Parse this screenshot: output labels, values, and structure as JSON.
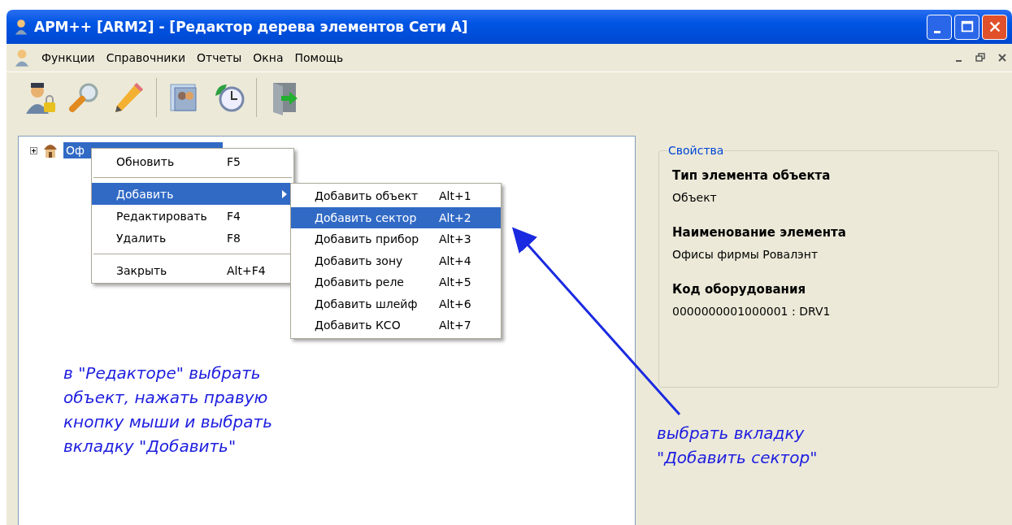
{
  "window": {
    "title": "АРМ++ [ARM2] - [Редактор дерева элементов Сети А]"
  },
  "menu_bar": [
    {
      "label": "Функции"
    },
    {
      "label": "Справочники"
    },
    {
      "label": "Отчеты"
    },
    {
      "label": "Окна"
    },
    {
      "label": "Помощь"
    }
  ],
  "tree": {
    "items": [
      {
        "label": "Оф",
        "selected": true,
        "expanded": false
      }
    ]
  },
  "context_menu": {
    "items": [
      {
        "kind": "item",
        "label": "Обновить",
        "shortcut": "F5",
        "selected": false,
        "submenu": false
      },
      {
        "kind": "separator"
      },
      {
        "kind": "item",
        "label": "Добавить",
        "selected": true,
        "submenu": true
      },
      {
        "kind": "item",
        "label": "Редактировать",
        "shortcut": "F4",
        "selected": false,
        "submenu": false
      },
      {
        "kind": "item",
        "label": "Удалить",
        "shortcut": "F8",
        "selected": false,
        "submenu": false
      },
      {
        "kind": "separator"
      },
      {
        "kind": "item",
        "label": "Закрыть",
        "shortcut": "Alt+F4",
        "selected": false,
        "submenu": false
      }
    ]
  },
  "submenu": {
    "items": [
      {
        "label": "Добавить объект",
        "shortcut": "Alt+1",
        "selected": false
      },
      {
        "label": "Добавить сектор",
        "shortcut": "Alt+2",
        "selected": true
      },
      {
        "label": "Добавить прибор",
        "shortcut": "Alt+3",
        "selected": false
      },
      {
        "label": "Добавить зону",
        "shortcut": "Alt+4",
        "selected": false
      },
      {
        "label": "Добавить реле",
        "shortcut": "Alt+5",
        "selected": false
      },
      {
        "label": "Добавить шлейф",
        "shortcut": "Alt+6",
        "selected": false
      },
      {
        "label": "Добавить КСО",
        "shortcut": "Alt+7",
        "selected": false
      }
    ]
  },
  "properties": {
    "title": "Свойства",
    "fields": [
      {
        "label": "Тип элемента объекта",
        "value": "Объект"
      },
      {
        "label": "Наименование элемента",
        "value": "Офисы фирмы Ровалэнт"
      },
      {
        "label": "Код оборудования",
        "value": "0000000001000001 : DRV1"
      }
    ]
  },
  "annotations": [
    {
      "text": "в \"Редакторе\" выбрать\nобъект, нажать правую\nкнопку мыши и выбрать\nвкладку \"Добавить\""
    },
    {
      "text": "выбрать вкладку\n\"Добавить сектор\""
    }
  ]
}
